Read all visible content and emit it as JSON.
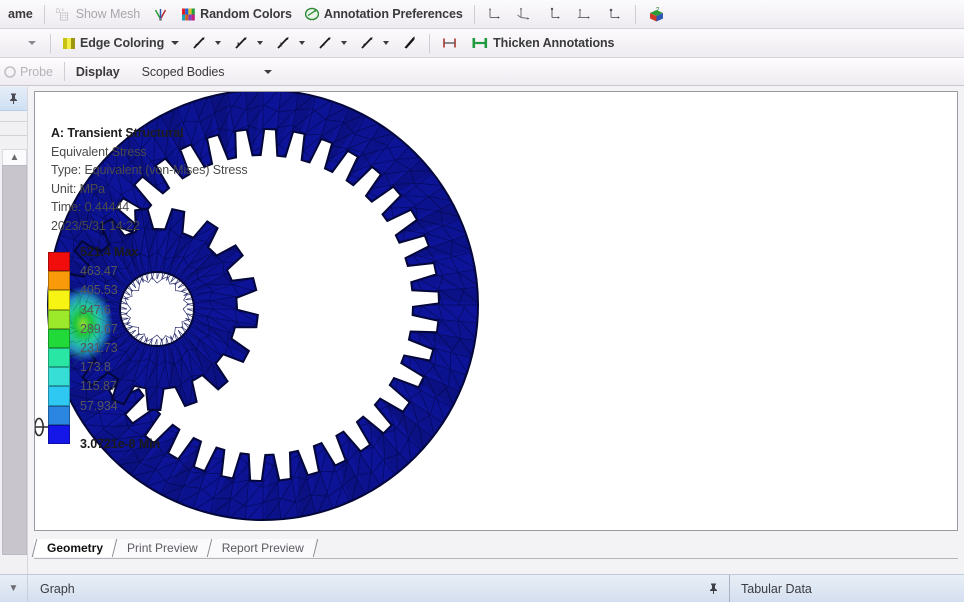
{
  "toolbar_row1": {
    "items": [
      {
        "name": "wireframe-button",
        "label": "ame",
        "icon": "none",
        "kind": "text",
        "bold": true,
        "disabled": false
      },
      {
        "name": "separator",
        "label": "",
        "icon": "sep",
        "kind": "sep"
      },
      {
        "name": "show-mesh-button",
        "label": "Show Mesh",
        "icon": "show-mesh-icon",
        "kind": "button",
        "disabled": true
      },
      {
        "name": "random-axes-button",
        "label": "",
        "icon": "random-axes-icon",
        "kind": "icon"
      },
      {
        "name": "random-colors-button",
        "label": "Random Colors",
        "icon": "random-colors-icon",
        "kind": "button"
      },
      {
        "name": "annotation-preferences-button",
        "label": "Annotation Preferences",
        "icon": "annotation-preferences-icon",
        "kind": "button"
      },
      {
        "name": "separator",
        "label": "",
        "icon": "sep",
        "kind": "sep"
      },
      {
        "name": "view-axis-1-button",
        "label": "",
        "icon": "axis-triad-icon",
        "kind": "icon"
      },
      {
        "name": "view-axis-2-button",
        "label": "",
        "icon": "axis-triad-icon",
        "kind": "icon"
      },
      {
        "name": "view-axis-3-button",
        "label": "",
        "icon": "axis-triad-icon",
        "kind": "icon"
      },
      {
        "name": "view-axis-4-button",
        "label": "",
        "icon": "axis-triad-icon",
        "kind": "icon"
      },
      {
        "name": "view-axis-5-button",
        "label": "",
        "icon": "axis-triad-icon",
        "kind": "icon"
      },
      {
        "name": "separator",
        "label": "",
        "icon": "sep",
        "kind": "sep"
      },
      {
        "name": "iso-view-button",
        "label": "",
        "icon": "view-cube-icon",
        "kind": "icon"
      }
    ]
  },
  "toolbar_row2": {
    "leading_dropdown": {
      "name": "toolbar-overflow-caret",
      "label": ""
    },
    "items": [
      {
        "name": "edge-coloring-button",
        "label": "Edge Coloring",
        "icon": "edge-coloring-icon",
        "caret": true
      },
      {
        "name": "edge-thickness-1-button",
        "label": "",
        "icon": "edge-style-icon",
        "caret": true
      },
      {
        "name": "edge-thickness-2-button",
        "label": "",
        "icon": "edge-style-icon",
        "caret": true
      },
      {
        "name": "edge-thickness-3-button",
        "label": "",
        "icon": "edge-style-icon",
        "caret": true
      },
      {
        "name": "edge-thickness-4-button",
        "label": "",
        "icon": "edge-style-icon",
        "caret": true
      },
      {
        "name": "edge-thickness-5-button",
        "label": "",
        "icon": "edge-style-icon",
        "caret": true
      },
      {
        "name": "show-vertices-button",
        "label": "",
        "icon": "show-vertices-icon",
        "caret": false
      },
      {
        "name": "separator",
        "label": "",
        "icon": "sep",
        "kind": "sep"
      },
      {
        "name": "annotation-size-button",
        "label": "",
        "icon": "annotation-size-icon",
        "caret": false
      },
      {
        "name": "thicken-annotations-button",
        "label": "Thicken Annotations",
        "icon": "thicken-annotations-icon",
        "caret": false
      }
    ]
  },
  "toolbar_row3": {
    "probe_label": "Probe",
    "display_label": "Display",
    "scoped_bodies_value": "Scoped Bodies"
  },
  "viewport": {
    "annotation": {
      "title": "A: Transient Structural",
      "lines": [
        "Equivalent Stress",
        "Type: Equivalent (von-Mises) Stress",
        "Unit: MPa",
        "Time: 0.44444",
        "2023/5/31 14:22"
      ]
    },
    "legend": {
      "max_label": "521.4 Max",
      "min_label": "3.0721e-8 Min",
      "bands": [
        {
          "color": "#f20d0d",
          "label": "521.4 Max",
          "bold": true
        },
        {
          "color": "#f89a0a",
          "label": "463.47",
          "bold": false
        },
        {
          "color": "#f7f312",
          "label": "405.53",
          "bold": false
        },
        {
          "color": "#9ce82a",
          "label": "347.6",
          "bold": false
        },
        {
          "color": "#22d93a",
          "label": "289.67",
          "bold": false
        },
        {
          "color": "#2ae6a4",
          "label": "231.73",
          "bold": false
        },
        {
          "color": "#36ded6",
          "label": "173.8",
          "bold": false
        },
        {
          "color": "#2fc8f2",
          "label": "115.87",
          "bold": false
        },
        {
          "color": "#2a86e0",
          "label": "57.934",
          "bold": false
        },
        {
          "color": "#1516e8",
          "label": "3.0721e-8 Min",
          "bold": true
        }
      ]
    },
    "model": {
      "ring_gear_name": "ring-gear-mesh",
      "pinion_gear_name": "pinion-gear-mesh",
      "axis_marker_name": "rotation-axis-marker",
      "mesh_color": "#0d1499",
      "mesh_edge_color": "#050a4d",
      "contact_colors": [
        "#2ae6a4",
        "#36ded6",
        "#2fc8f2",
        "#9ce82a",
        "#22d93a"
      ]
    }
  },
  "bottom_tabs": {
    "tabs": [
      {
        "label": "Geometry",
        "active": true
      },
      {
        "label": "Print Preview",
        "active": false
      },
      {
        "label": "Report Preview",
        "active": false
      }
    ]
  },
  "statusbar": {
    "graph_label": "Graph",
    "tabular_label": "Tabular Data"
  }
}
